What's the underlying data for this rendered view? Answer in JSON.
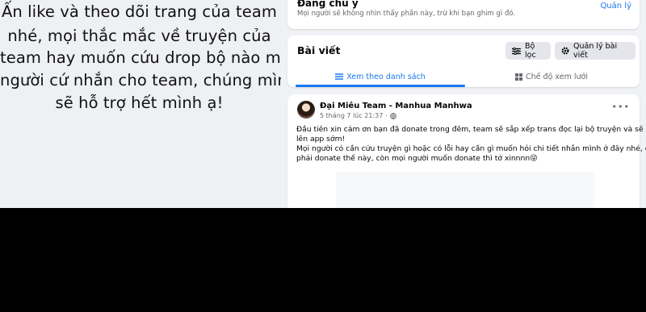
{
  "promo": {
    "lines": [
      "Ấn like và theo dõi trang của team",
      "nhé, mọi thắc mắc về truyện của",
      "team hay muốn cứu drop bộ nào mọi",
      "người cứ nhắn cho team, chúng mình",
      "sẽ hỗ trợ hết mình ạ!"
    ]
  },
  "top_card": {
    "title": "Đang chú ý",
    "subtitle": "Mọi người sẽ không nhìn thấy phần này, trừ khi bạn ghim gì đó.",
    "manage_link": "Quản lý"
  },
  "posts_card": {
    "title": "Bài viết",
    "filter_button": "Bộ lọc",
    "manage_button": "Quản lý bài viết",
    "tabs": [
      {
        "label": "Xem theo danh sách",
        "icon": "list-icon",
        "active": true
      },
      {
        "label": "Chế độ xem lưới",
        "icon": "grid-icon",
        "active": false
      }
    ]
  },
  "post": {
    "author": "Đại Miêu Team - Manhua Manhwa",
    "timestamp": "5 tháng 7 lúc 21:37",
    "audience_icon": "globe-icon",
    "more_icon": "more-dots-icon",
    "body_lines": [
      "Đầu tiên xin cảm ơn bạn đã donate trong đêm, team sẽ sắp xếp trans đọc lại bộ truyện và sẽ đưa",
      "lên app sớm!",
      "Mọi người có cần cứu truyện gì hoặc có lỗi hay cần gì muốn hỏi chi tiết nhắn mình ở đây nhé, đỡ",
      "phải donate thế này, còn mọi người muốn donate thì tớ xinnnn😜"
    ]
  },
  "colors": {
    "accent": "#1877f2",
    "page_bg": "#f0f2f5",
    "secondary_text": "#65676b"
  }
}
